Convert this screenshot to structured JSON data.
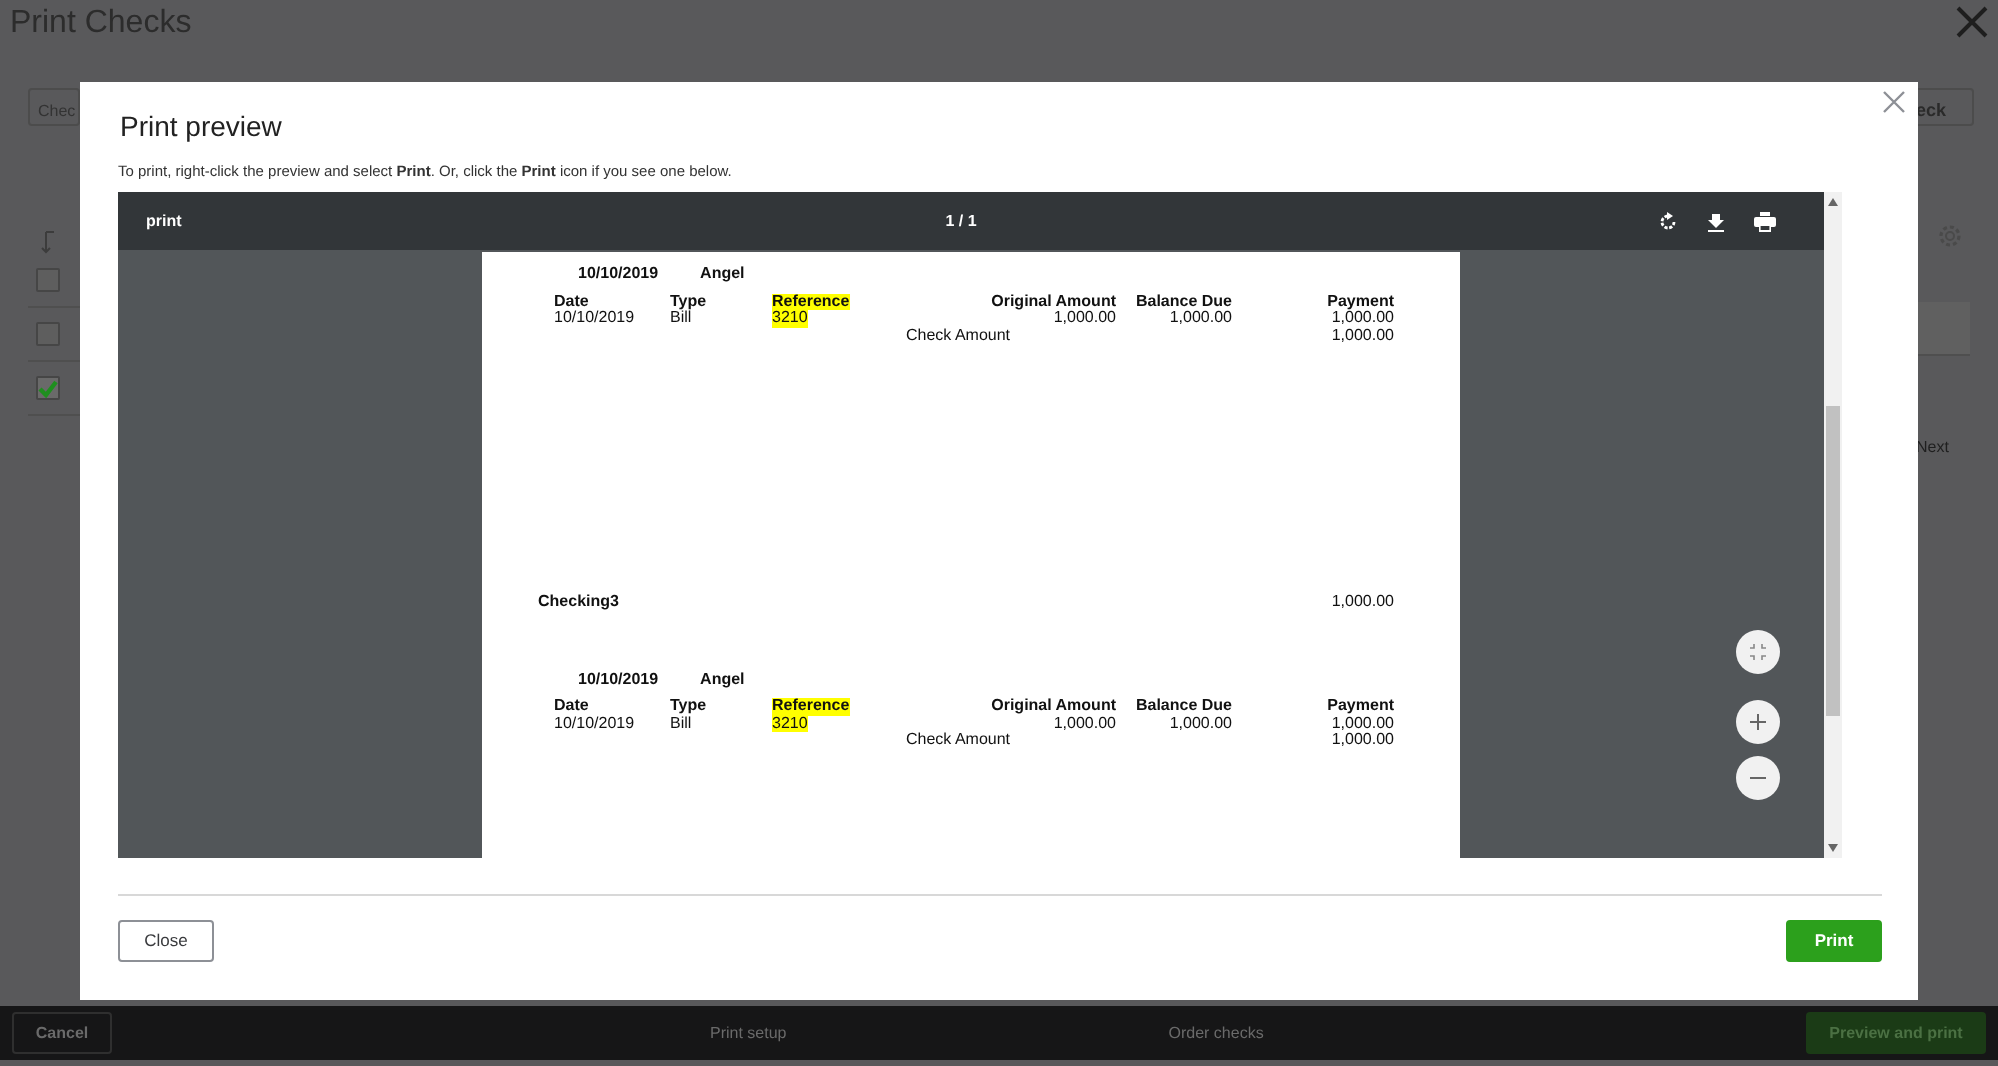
{
  "page_title": "Print Checks",
  "background": {
    "account_field": "Chec",
    "right_button": "eck",
    "checkboxes": [
      {
        "checked": false
      },
      {
        "checked": false
      },
      {
        "checked": true
      }
    ],
    "pager_next": "Next",
    "footer": {
      "cancel": "Cancel",
      "print_setup": "Print setup",
      "order_checks": "Order checks",
      "preview_and_print": "Preview and print"
    }
  },
  "dialog": {
    "title": "Print preview",
    "instructions": "To print, right-click the preview and select **Print**. Or, click the **Print** icon if you see one below.",
    "viewer": {
      "file_name": "print",
      "page_counter": "1 / 1",
      "document": [
        {
          "kind": "stub",
          "date": "10/10/2019",
          "payee": "Angel",
          "columns": [
            {
              "label": "Date",
              "highlighted": false
            },
            {
              "label": "Type",
              "highlighted": false
            },
            {
              "label": "Reference",
              "highlighted": true
            },
            {
              "label": "Original Amount",
              "highlighted": false
            },
            {
              "label": "Balance Due",
              "highlighted": false
            },
            {
              "label": "Payment",
              "highlighted": false
            }
          ],
          "rows": [
            [
              "10/10/2019",
              "Bill",
              "3210",
              "1,000.00",
              "1,000.00",
              "1,000.00"
            ]
          ],
          "total_label": "Check Amount",
          "total": "1,000.00"
        },
        {
          "kind": "check",
          "account": "Checking3",
          "amount": "1,000.00"
        },
        {
          "kind": "stub",
          "date": "10/10/2019",
          "payee": "Angel",
          "columns": [
            {
              "label": "Date",
              "highlighted": false
            },
            {
              "label": "Type",
              "highlighted": false
            },
            {
              "label": "Reference",
              "highlighted": true
            },
            {
              "label": "Original Amount",
              "highlighted": false
            },
            {
              "label": "Balance Due",
              "highlighted": false
            },
            {
              "label": "Payment",
              "highlighted": false
            }
          ],
          "rows": [
            [
              "10/10/2019",
              "Bill",
              "3210",
              "1,000.00",
              "1,000.00",
              "1,000.00"
            ]
          ],
          "total_label": "Check Amount",
          "total": "1,000.00"
        }
      ]
    },
    "buttons": [
      {
        "label": "Close",
        "kind": "secondary"
      },
      {
        "label": "Print",
        "kind": "primary"
      }
    ]
  }
}
